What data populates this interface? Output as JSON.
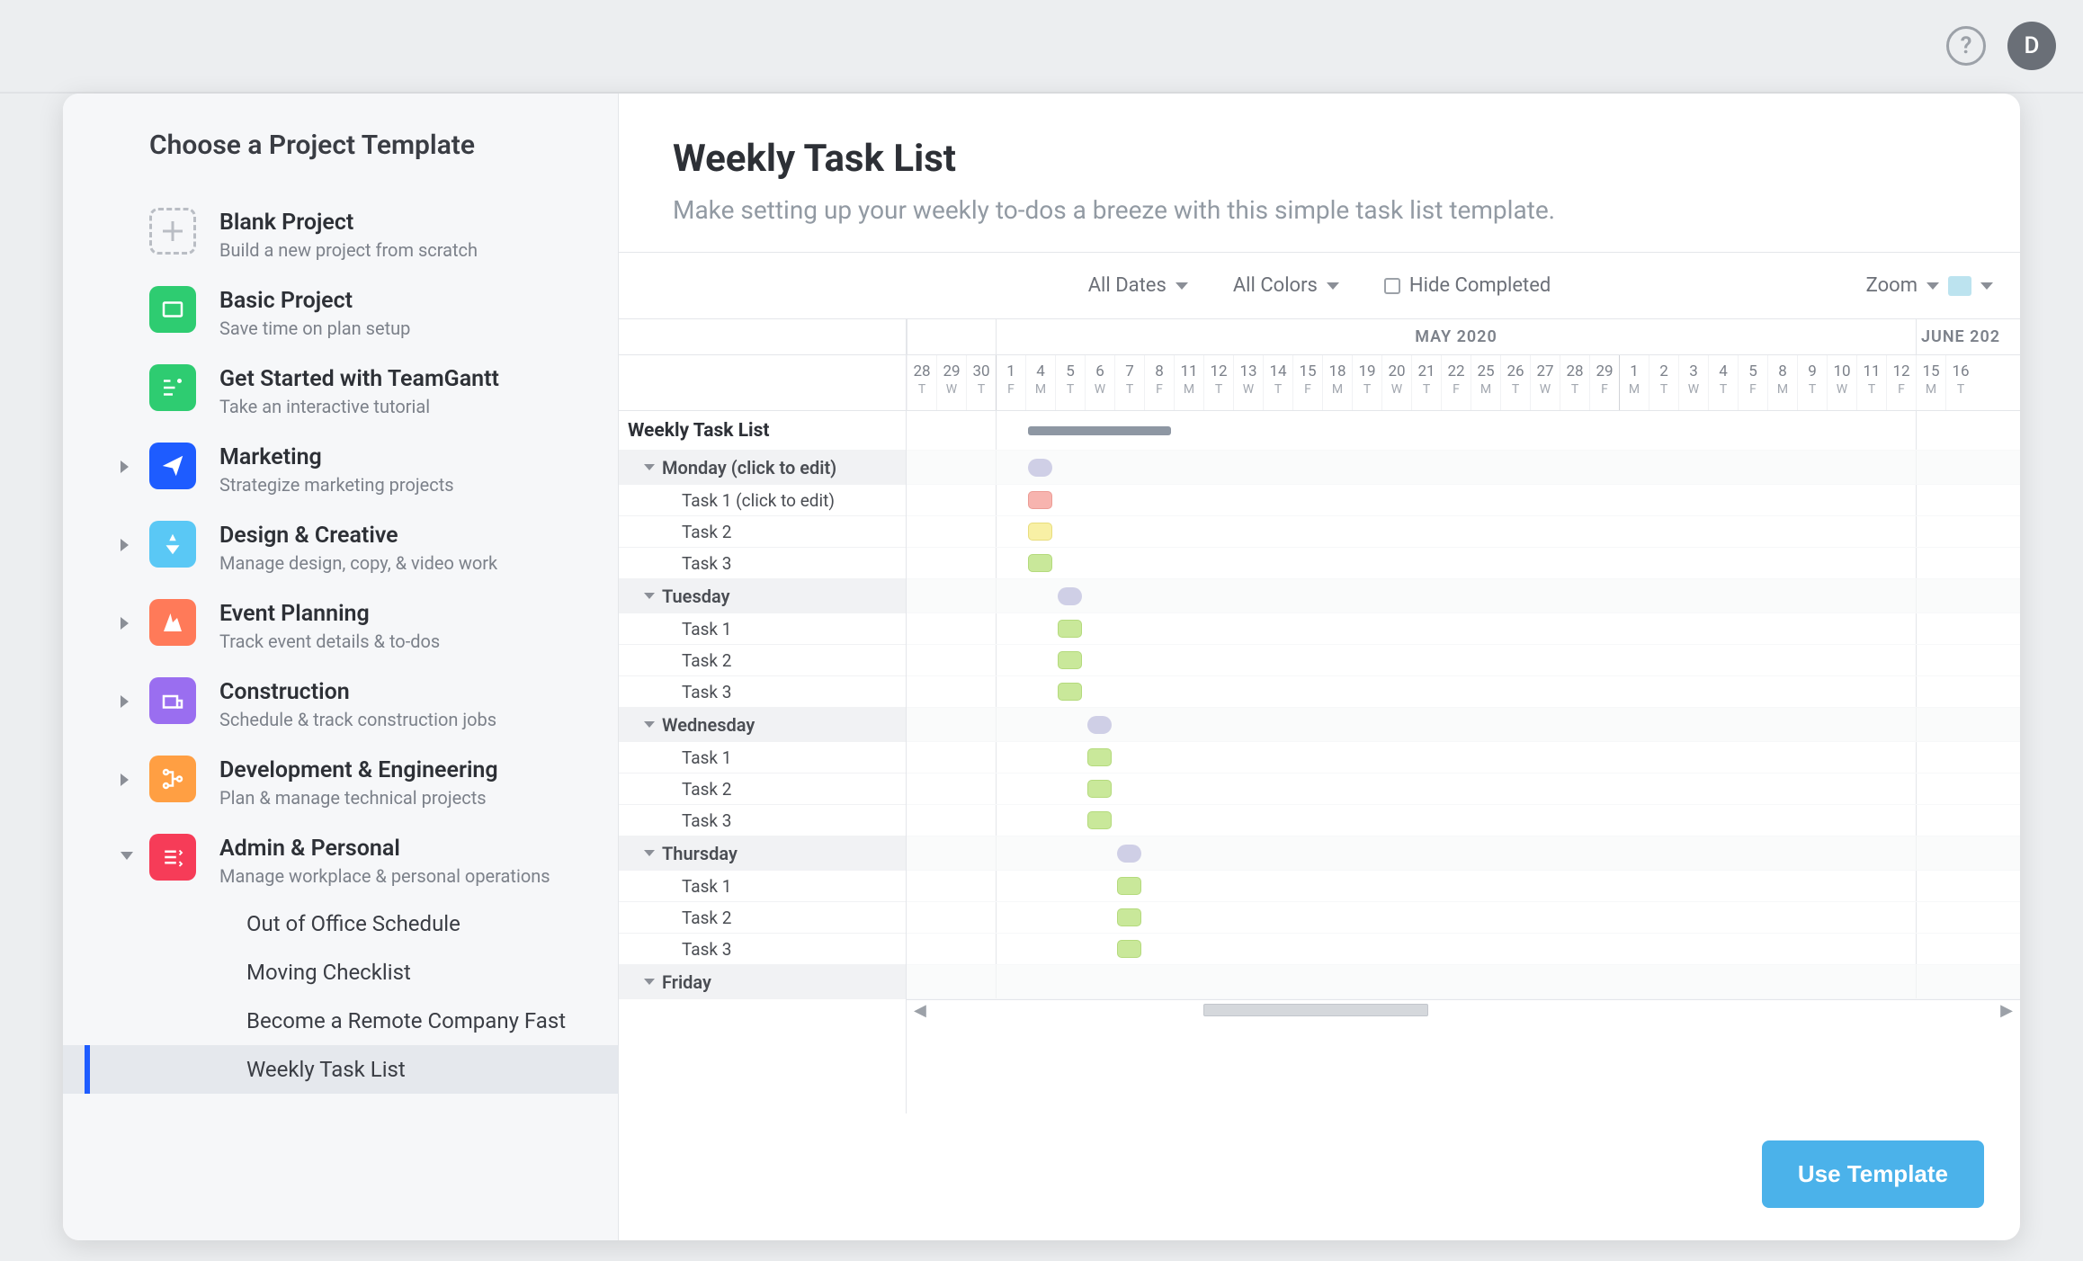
{
  "topbar": {
    "help_glyph": "?",
    "avatar_letter": "D"
  },
  "sidebar": {
    "title": "Choose a Project Template",
    "templates": [
      {
        "name": "Blank Project",
        "desc": "Build a new project from scratch",
        "icon": "blank",
        "expandable": false
      },
      {
        "name": "Basic Project",
        "desc": "Save time on plan setup",
        "icon": "basic",
        "expandable": false
      },
      {
        "name": "Get Started with TeamGantt",
        "desc": "Take an interactive tutorial",
        "icon": "getstarted",
        "expandable": false
      },
      {
        "name": "Marketing",
        "desc": "Strategize marketing projects",
        "icon": "marketing",
        "expandable": true,
        "expanded": false
      },
      {
        "name": "Design & Creative",
        "desc": "Manage design, copy, & video work",
        "icon": "design",
        "expandable": true,
        "expanded": false
      },
      {
        "name": "Event Planning",
        "desc": "Track event details & to-dos",
        "icon": "event",
        "expandable": true,
        "expanded": false
      },
      {
        "name": "Construction",
        "desc": "Schedule & track construction jobs",
        "icon": "construction",
        "expandable": true,
        "expanded": false
      },
      {
        "name": "Development & Engineering",
        "desc": "Plan & manage technical projects",
        "icon": "dev",
        "expandable": true,
        "expanded": false
      },
      {
        "name": "Admin & Personal",
        "desc": "Manage workplace & personal operations",
        "icon": "admin",
        "expandable": true,
        "expanded": true
      }
    ],
    "admin_sub": [
      {
        "label": "Out of Office Schedule",
        "active": false
      },
      {
        "label": "Moving Checklist",
        "active": false
      },
      {
        "label": "Become a Remote Company Fast",
        "active": false
      },
      {
        "label": "Weekly Task List",
        "active": true
      }
    ]
  },
  "main": {
    "title": "Weekly Task List",
    "subtitle": "Make setting up your weekly to-dos a breeze with this simple task list template.",
    "controls": {
      "dates": "All Dates",
      "colors": "All Colors",
      "hide_completed": "Hide Completed",
      "zoom": "Zoom"
    },
    "use_template": "Use Template"
  },
  "gantt": {
    "months": [
      {
        "label": "",
        "span": 3
      },
      {
        "label": "MAY 2020",
        "span": 31
      },
      {
        "label": "JUNE 202",
        "span": 3
      }
    ],
    "days": [
      {
        "n": "28",
        "d": "T"
      },
      {
        "n": "29",
        "d": "W"
      },
      {
        "n": "30",
        "d": "T"
      },
      {
        "n": "1",
        "d": "F",
        "mstart": true
      },
      {
        "n": "4",
        "d": "M"
      },
      {
        "n": "5",
        "d": "T"
      },
      {
        "n": "6",
        "d": "W"
      },
      {
        "n": "7",
        "d": "T"
      },
      {
        "n": "8",
        "d": "F"
      },
      {
        "n": "11",
        "d": "M"
      },
      {
        "n": "12",
        "d": "T"
      },
      {
        "n": "13",
        "d": "W"
      },
      {
        "n": "14",
        "d": "T"
      },
      {
        "n": "15",
        "d": "F"
      },
      {
        "n": "18",
        "d": "M"
      },
      {
        "n": "19",
        "d": "T"
      },
      {
        "n": "20",
        "d": "W"
      },
      {
        "n": "21",
        "d": "T"
      },
      {
        "n": "22",
        "d": "F"
      },
      {
        "n": "25",
        "d": "M"
      },
      {
        "n": "26",
        "d": "T"
      },
      {
        "n": "27",
        "d": "W"
      },
      {
        "n": "28",
        "d": "T"
      },
      {
        "n": "29",
        "d": "F"
      },
      {
        "n": "1",
        "d": "M",
        "mstart": true
      },
      {
        "n": "2",
        "d": "T"
      },
      {
        "n": "3",
        "d": "W"
      },
      {
        "n": "4",
        "d": "T"
      },
      {
        "n": "5",
        "d": "F"
      },
      {
        "n": "8",
        "d": "M"
      },
      {
        "n": "9",
        "d": "T"
      },
      {
        "n": "10",
        "d": "W"
      },
      {
        "n": "11",
        "d": "T"
      },
      {
        "n": "12",
        "d": "F"
      },
      {
        "n": "15",
        "d": "M"
      },
      {
        "n": "16",
        "d": "T"
      }
    ],
    "rows": [
      {
        "type": "project",
        "label": "Weekly Task List",
        "bar": {
          "start": 4,
          "span": 5,
          "cls": "summary"
        }
      },
      {
        "type": "group",
        "label": "Monday (click to edit)",
        "bar": {
          "start": 4,
          "span": 1,
          "cls": "pill c-lav"
        }
      },
      {
        "type": "task",
        "label": "Task 1 (click to edit)",
        "bar": {
          "start": 4,
          "span": 1,
          "cls": "c-red"
        }
      },
      {
        "type": "task",
        "label": "Task 2",
        "bar": {
          "start": 4,
          "span": 1,
          "cls": "c-yel"
        }
      },
      {
        "type": "task",
        "label": "Task 3",
        "bar": {
          "start": 4,
          "span": 1,
          "cls": "c-grn"
        }
      },
      {
        "type": "group",
        "label": "Tuesday",
        "bar": {
          "start": 5,
          "span": 1,
          "cls": "pill c-lav"
        }
      },
      {
        "type": "task",
        "label": "Task 1",
        "bar": {
          "start": 5,
          "span": 1,
          "cls": "c-grn"
        }
      },
      {
        "type": "task",
        "label": "Task 2",
        "bar": {
          "start": 5,
          "span": 1,
          "cls": "c-grn"
        }
      },
      {
        "type": "task",
        "label": "Task 3",
        "bar": {
          "start": 5,
          "span": 1,
          "cls": "c-grn"
        }
      },
      {
        "type": "group",
        "label": "Wednesday",
        "bar": {
          "start": 6,
          "span": 1,
          "cls": "pill c-lav"
        }
      },
      {
        "type": "task",
        "label": "Task 1",
        "bar": {
          "start": 6,
          "span": 1,
          "cls": "c-grn"
        }
      },
      {
        "type": "task",
        "label": "Task 2",
        "bar": {
          "start": 6,
          "span": 1,
          "cls": "c-grn"
        }
      },
      {
        "type": "task",
        "label": "Task 3",
        "bar": {
          "start": 6,
          "span": 1,
          "cls": "c-grn"
        }
      },
      {
        "type": "group",
        "label": "Thursday",
        "bar": {
          "start": 7,
          "span": 1,
          "cls": "pill c-lav"
        }
      },
      {
        "type": "task",
        "label": "Task 1",
        "bar": {
          "start": 7,
          "span": 1,
          "cls": "c-grn"
        }
      },
      {
        "type": "task",
        "label": "Task 2",
        "bar": {
          "start": 7,
          "span": 1,
          "cls": "c-grn"
        }
      },
      {
        "type": "task",
        "label": "Task 3",
        "bar": {
          "start": 7,
          "span": 1,
          "cls": "c-grn"
        }
      },
      {
        "type": "group",
        "label": "Friday",
        "bar": null
      }
    ]
  }
}
